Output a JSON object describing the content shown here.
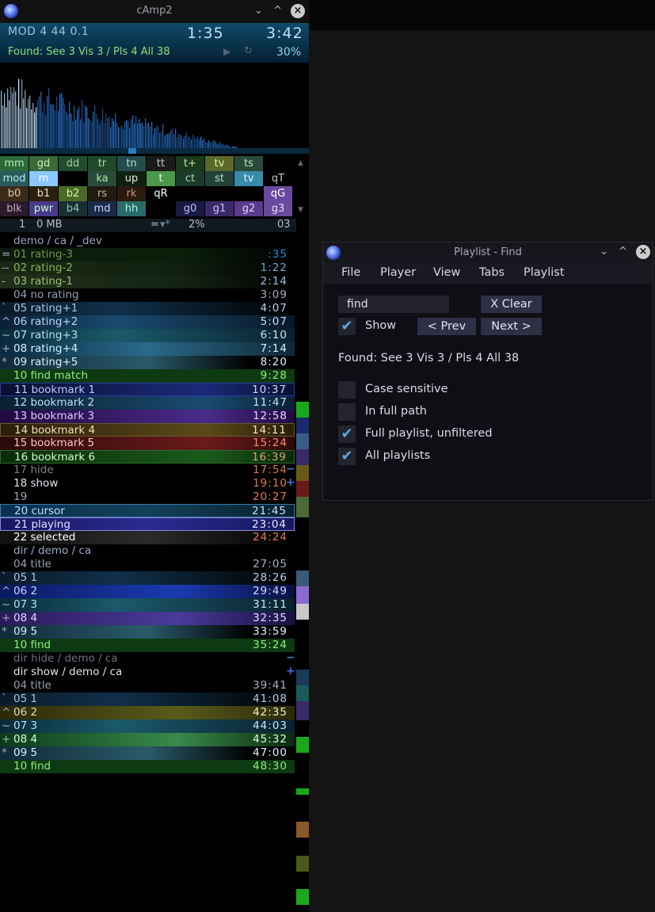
{
  "main_window": {
    "title": "cAmp2",
    "minimize_glyph": "⌄",
    "maximize_glyph": "^",
    "close_glyph": "×"
  },
  "info": {
    "mod": "MOD  4 44  0.1",
    "time_current": "1:35",
    "time_total": "3:42",
    "found": "Found: See  3 Vis  3 / Pls  4   All 38",
    "play_glyph": "▶",
    "repeat_glyph": "↻",
    "percent": "30%"
  },
  "viz": {
    "level_from": 0.82,
    "level_to": 0.0,
    "bar_color": "#2a74d0",
    "peak_color": "#bfe4ff"
  },
  "grid": {
    "row1": [
      "mm",
      "gd",
      "dd",
      "tr",
      "tn",
      "tt",
      "t+",
      "tv",
      "ts"
    ],
    "row2": [
      "mod",
      "m",
      "",
      "ka",
      "up",
      "t",
      "ct",
      "st",
      "tv",
      "qT"
    ],
    "row3": [
      "b0",
      "b1",
      "b2",
      "rs",
      "rk",
      "qR",
      "qG"
    ],
    "row4": [
      "blk",
      "pwr",
      "b4",
      "md",
      "hh",
      "g0",
      "g1",
      "g2",
      "g3"
    ],
    "scroll_up": "▲",
    "scroll_down": "▼"
  },
  "status": {
    "num": "1",
    "size": "0 MB",
    "eq": "=",
    "filter_glyph": "▾*",
    "percent": "2%",
    "index": "03"
  },
  "playlist": {
    "rows": [
      {
        "pre": "",
        "label": "demo / ca / _dev",
        "time": "",
        "kind": "dir"
      },
      {
        "pre": "=",
        "label": "01 rating-3",
        "time": ":35",
        "kind": "r3"
      },
      {
        "pre": "--",
        "label": "02 rating-2",
        "time": "1:22",
        "kind": "r2"
      },
      {
        "pre": "-",
        "label": "03 rating-1",
        "time": "2:14",
        "kind": "r1"
      },
      {
        "pre": "",
        "label": "04 no rating",
        "time": "3:09",
        "kind": "r0"
      },
      {
        "pre": "`",
        "label": "05 rating+1",
        "time": "4:07",
        "kind": "p1"
      },
      {
        "pre": "^",
        "label": "06 rating+2",
        "time": "5:07",
        "kind": "p2"
      },
      {
        "pre": "~",
        "label": "07 rating+3",
        "time": "6:10",
        "kind": "p3"
      },
      {
        "pre": "+",
        "label": "08 rating+4",
        "time": "7:14",
        "kind": "p4"
      },
      {
        "pre": "*",
        "label": "09 rating+5",
        "time": "8:20",
        "kind": "p5"
      },
      {
        "pre": "",
        "label": "10 find match",
        "time": "9:28",
        "kind": "find"
      },
      {
        "pre": "",
        "label": "11 bookmark 1",
        "time": "10:37",
        "kind": "bm1"
      },
      {
        "pre": "",
        "label": "12 bookmark 2",
        "time": "11:47",
        "kind": "bm2"
      },
      {
        "pre": "",
        "label": "13 bookmark 3",
        "time": "12:58",
        "kind": "bm3"
      },
      {
        "pre": "",
        "label": "14 bookmark 4",
        "time": "14:11",
        "kind": "bm4"
      },
      {
        "pre": "",
        "label": "15 bookmark 5",
        "time": "15:24",
        "kind": "bm5"
      },
      {
        "pre": "",
        "label": "16 bookmark 6",
        "time": "16:39",
        "kind": "bm6"
      },
      {
        "pre": "",
        "label": "17 hide",
        "time": "17:54",
        "kind": "hide"
      },
      {
        "pre": "",
        "label": "18 show",
        "time": "19:10",
        "kind": "show"
      },
      {
        "pre": "",
        "label": "19",
        "time": "20:27",
        "kind": "plain"
      },
      {
        "pre": "",
        "label": "20 cursor",
        "time": "21:45",
        "kind": "cursor"
      },
      {
        "pre": "",
        "label": "21 playing",
        "time": "23:04",
        "kind": "playing"
      },
      {
        "pre": "",
        "label": "22 selected",
        "time": "24:24",
        "kind": "selected"
      },
      {
        "pre": "",
        "label": "dir / demo / ca",
        "time": "",
        "kind": "dir"
      },
      {
        "pre": "",
        "label": "04 title",
        "time": "27:05",
        "kind": "r0"
      },
      {
        "pre": "`",
        "label": "05 1",
        "time": "28:26",
        "kind": "p1"
      },
      {
        "pre": "^",
        "label": "06 2",
        "time": "29:49",
        "kind": "p2x"
      },
      {
        "pre": "~",
        "label": "07 3",
        "time": "31:11",
        "kind": "p3"
      },
      {
        "pre": "+",
        "label": "08 4",
        "time": "32:35",
        "kind": "p4x"
      },
      {
        "pre": "*",
        "label": "09 5",
        "time": "33:59",
        "kind": "p5"
      },
      {
        "pre": "",
        "label": "10 find",
        "time": "35:24",
        "kind": "find"
      },
      {
        "pre": "",
        "label": "dir hide / demo / ca",
        "time": "",
        "kind": "dirhide"
      },
      {
        "pre": "",
        "label": "dir show / demo / ca",
        "time": "",
        "kind": "dirshow"
      },
      {
        "pre": "",
        "label": "04 title",
        "time": "39:41",
        "kind": "r0"
      },
      {
        "pre": "`",
        "label": "05 1",
        "time": "41:08",
        "kind": "p1"
      },
      {
        "pre": "^",
        "label": "06 2",
        "time": "42:35",
        "kind": "p2y"
      },
      {
        "pre": "~",
        "label": "07 3",
        "time": "44:03",
        "kind": "p3"
      },
      {
        "pre": "+",
        "label": "08 4",
        "time": "45:32",
        "kind": "p4g"
      },
      {
        "pre": "*",
        "label": "09 5",
        "time": "47:00",
        "kind": "p5"
      },
      {
        "pre": "",
        "label": "10 find",
        "time": "48:30",
        "kind": "find"
      }
    ],
    "hide_mark": "−",
    "show_mark": "+"
  },
  "find_dialog": {
    "title": "Playlist - Find",
    "menu": [
      "File",
      "Player",
      "View",
      "Tabs",
      "Playlist"
    ],
    "search_value": "find",
    "clear_label": "X Clear",
    "show_label": "Show",
    "prev_label": "< Prev",
    "next_label": "Next >",
    "found_text": "Found: See 3 Vis 3 / Pls 4  All 38",
    "check_glyph": "✔",
    "options": [
      {
        "label": "Case sensitive",
        "checked": false
      },
      {
        "label": "In full path",
        "checked": false
      },
      {
        "label": "Full playlist, unfiltered",
        "checked": true
      },
      {
        "label": "All playlists",
        "checked": true
      }
    ],
    "show_checked": true
  },
  "colors": {
    "accent": "#5aa8e6",
    "found_green": "#8ee07a",
    "find_match_bg": "#0d3a12",
    "time_orange": "#e07a4a"
  }
}
